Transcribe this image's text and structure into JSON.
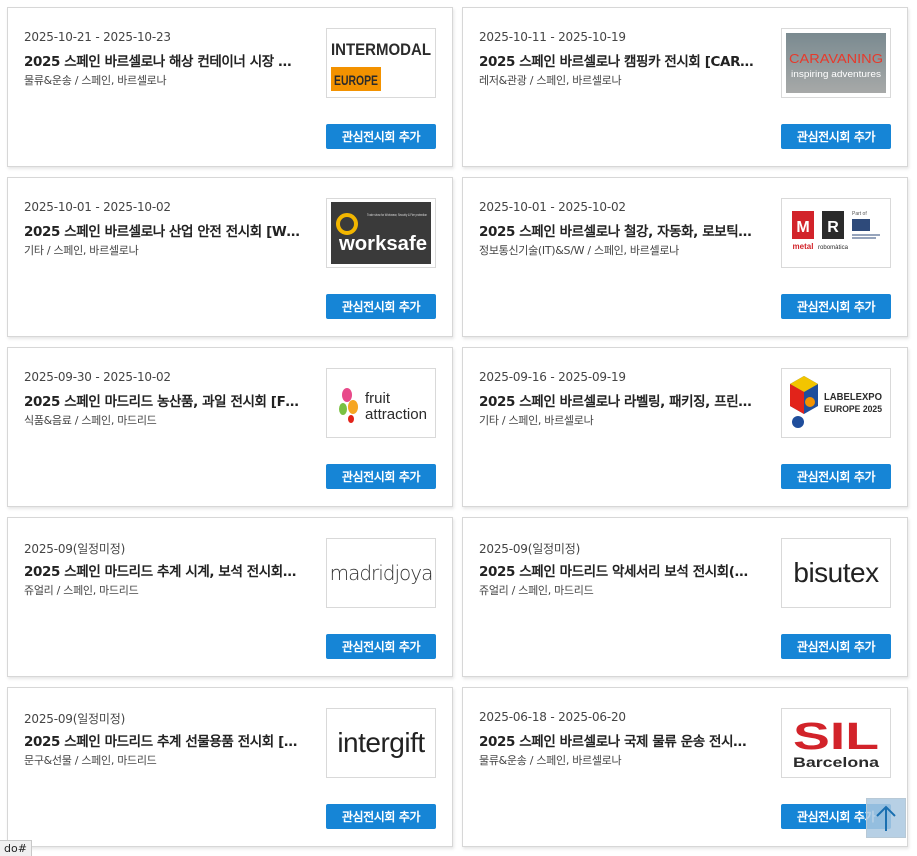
{
  "button_label": "관심전시회 추가",
  "cards": [
    {
      "dates": "2025-10-21 - 2025-10-23",
      "title": "2025 스페인 바르셀로나 해상 컨테이너 시장 …",
      "meta": "물류&운송 / 스페인, 바르셀로나",
      "logo": "intermodal"
    },
    {
      "dates": "2025-10-11 - 2025-10-19",
      "title": "2025 스페인 바르셀로나 캠핑카 전시회 [CAR…",
      "meta": "레저&관광 / 스페인, 바르셀로나",
      "logo": "caravaning"
    },
    {
      "dates": "2025-10-01 - 2025-10-02",
      "title": "2025 스페인 바르셀로나 산업 안전 전시회 [W…",
      "meta": "기타 / 스페인, 바르셀로나",
      "logo": "worksafe"
    },
    {
      "dates": "2025-10-01 - 2025-10-02",
      "title": "2025 스페인 바르셀로나 철강, 자동화, 로보틱…",
      "meta": "정보통신기술(IT)&S/W / 스페인, 바르셀로나",
      "logo": "metal"
    },
    {
      "dates": "2025-09-30 - 2025-10-02",
      "title": "2025 스페인 마드리드 농산품, 과일 전시회 [F…",
      "meta": "식품&음료 / 스페인, 마드리드",
      "logo": "fruit"
    },
    {
      "dates": "2025-09-16 - 2025-09-19",
      "title": "2025 스페인 바르셀로나 라벨링, 패키징, 프린…",
      "meta": "기타 / 스페인, 바르셀로나",
      "logo": "labelexpo"
    },
    {
      "dates": "2025-09(일정미정)",
      "title": "2025 스페인 마드리드 추계 시계, 보석 전시회…",
      "meta": "쥬얼리 / 스페인, 마드리드",
      "logo": "madridjoya"
    },
    {
      "dates": "2025-09(일정미정)",
      "title": "2025 스페인 마드리드 악세서리 보석 전시회(…",
      "meta": "쥬얼리 / 스페인, 마드리드",
      "logo": "bisutex"
    },
    {
      "dates": "2025-09(일정미정)",
      "title": "2025 스페인 마드리드 추계 선물용품 전시회 […",
      "meta": "문구&선물 / 스페인, 마드리드",
      "logo": "intergift"
    },
    {
      "dates": "2025-06-18 - 2025-06-20",
      "title": "2025 스페인 바르셀로나 국제 물류 운송 전시…",
      "meta": "물류&운송 / 스페인, 바르셀로나",
      "logo": "sil"
    }
  ],
  "logos": {
    "intermodal": {
      "line1": "INTERMODAL",
      "line2": "EUROPE"
    },
    "caravaning": {
      "line1": "CARAVANING",
      "line2": "inspiring adventures"
    },
    "worksafe": {
      "line1": "worksafe",
      "tagline": "Trade show for Workwear, Security & Fire protection"
    },
    "metal": {
      "word1": "metal",
      "word2": "robomàtica",
      "part_of": "Part of"
    },
    "fruit": {
      "line1": "fruit",
      "line2": "attraction"
    },
    "labelexpo": {
      "line1": "LABELEXPO",
      "line2": "EUROPE 2025"
    },
    "madridjoya": {
      "text": "madridjoya"
    },
    "bisutex": {
      "text": "bisutex"
    },
    "intergift": {
      "text": "intergift"
    },
    "sil": {
      "line1": "SIL",
      "line2": "Barcelona"
    }
  },
  "scroll_top_icon": "arrow-up-icon",
  "status_url": "do#",
  "colors": {
    "button": "#1685d6",
    "sil_red": "#d2232a",
    "intermodal_orange": "#f39200"
  }
}
